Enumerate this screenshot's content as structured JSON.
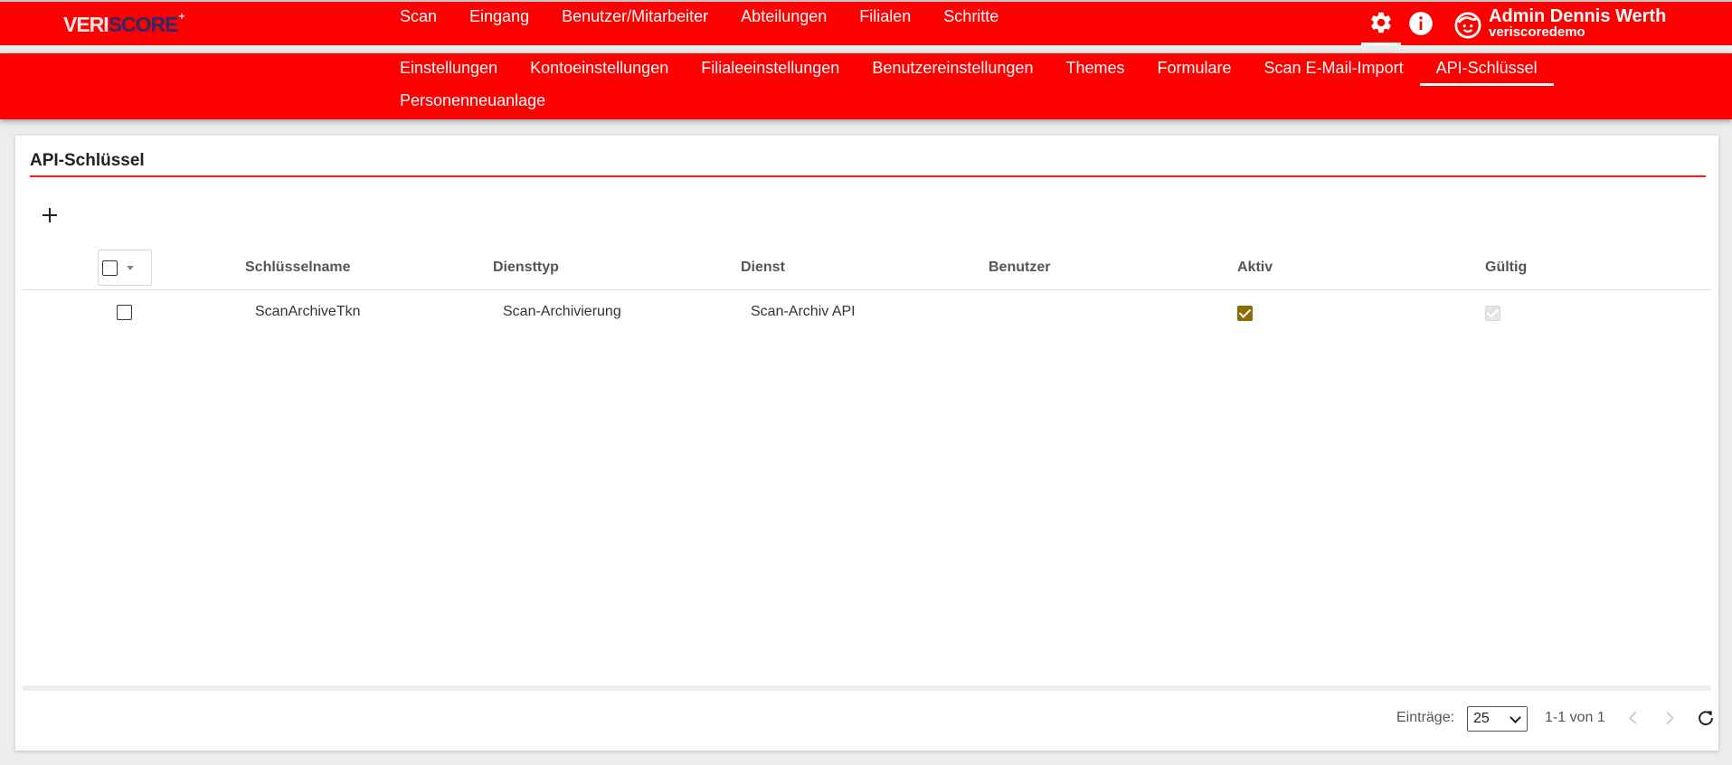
{
  "app": {
    "logo_part1": "VERI",
    "logo_part2": "SCORE",
    "logo_mark": "+"
  },
  "main_nav": [
    {
      "label": "Scan"
    },
    {
      "label": "Eingang"
    },
    {
      "label": "Benutzer/Mitarbeiter"
    },
    {
      "label": "Abteilungen"
    },
    {
      "label": "Filialen"
    },
    {
      "label": "Schritte"
    }
  ],
  "header_icons": {
    "settings": "gear-icon",
    "info": "info-icon",
    "user": "smiley-avatar-icon"
  },
  "user": {
    "name": "Admin Dennis Werth",
    "account": "veriscoredemo"
  },
  "sub_nav": [
    {
      "label": "Einstellungen"
    },
    {
      "label": "Kontoeinstellungen"
    },
    {
      "label": "Filialeeinstellungen"
    },
    {
      "label": "Benutzereinstellungen"
    },
    {
      "label": "Themes"
    },
    {
      "label": "Formulare"
    },
    {
      "label": "Scan E-Mail-Import"
    },
    {
      "label": "API-Schlüssel",
      "active": true
    },
    {
      "label": "Personenneuanlage"
    }
  ],
  "page": {
    "title": "API-Schlüssel",
    "add_icon": "plus-icon"
  },
  "grid": {
    "columns": [
      "Schlüsselname",
      "Diensttyp",
      "Dienst",
      "Benutzer",
      "Aktiv",
      "Gültig"
    ],
    "rows": [
      {
        "name": "ScanArchiveTkn",
        "service_type": "Scan-Archivierung",
        "service": "Scan-Archiv API",
        "user": "",
        "active": true,
        "valid": true
      }
    ]
  },
  "pager": {
    "label": "Einträge:",
    "page_size": "25",
    "range": "1-1 von 1"
  },
  "colors": {
    "brand_red": "#ff0000",
    "active_check": "#8a6d05"
  }
}
